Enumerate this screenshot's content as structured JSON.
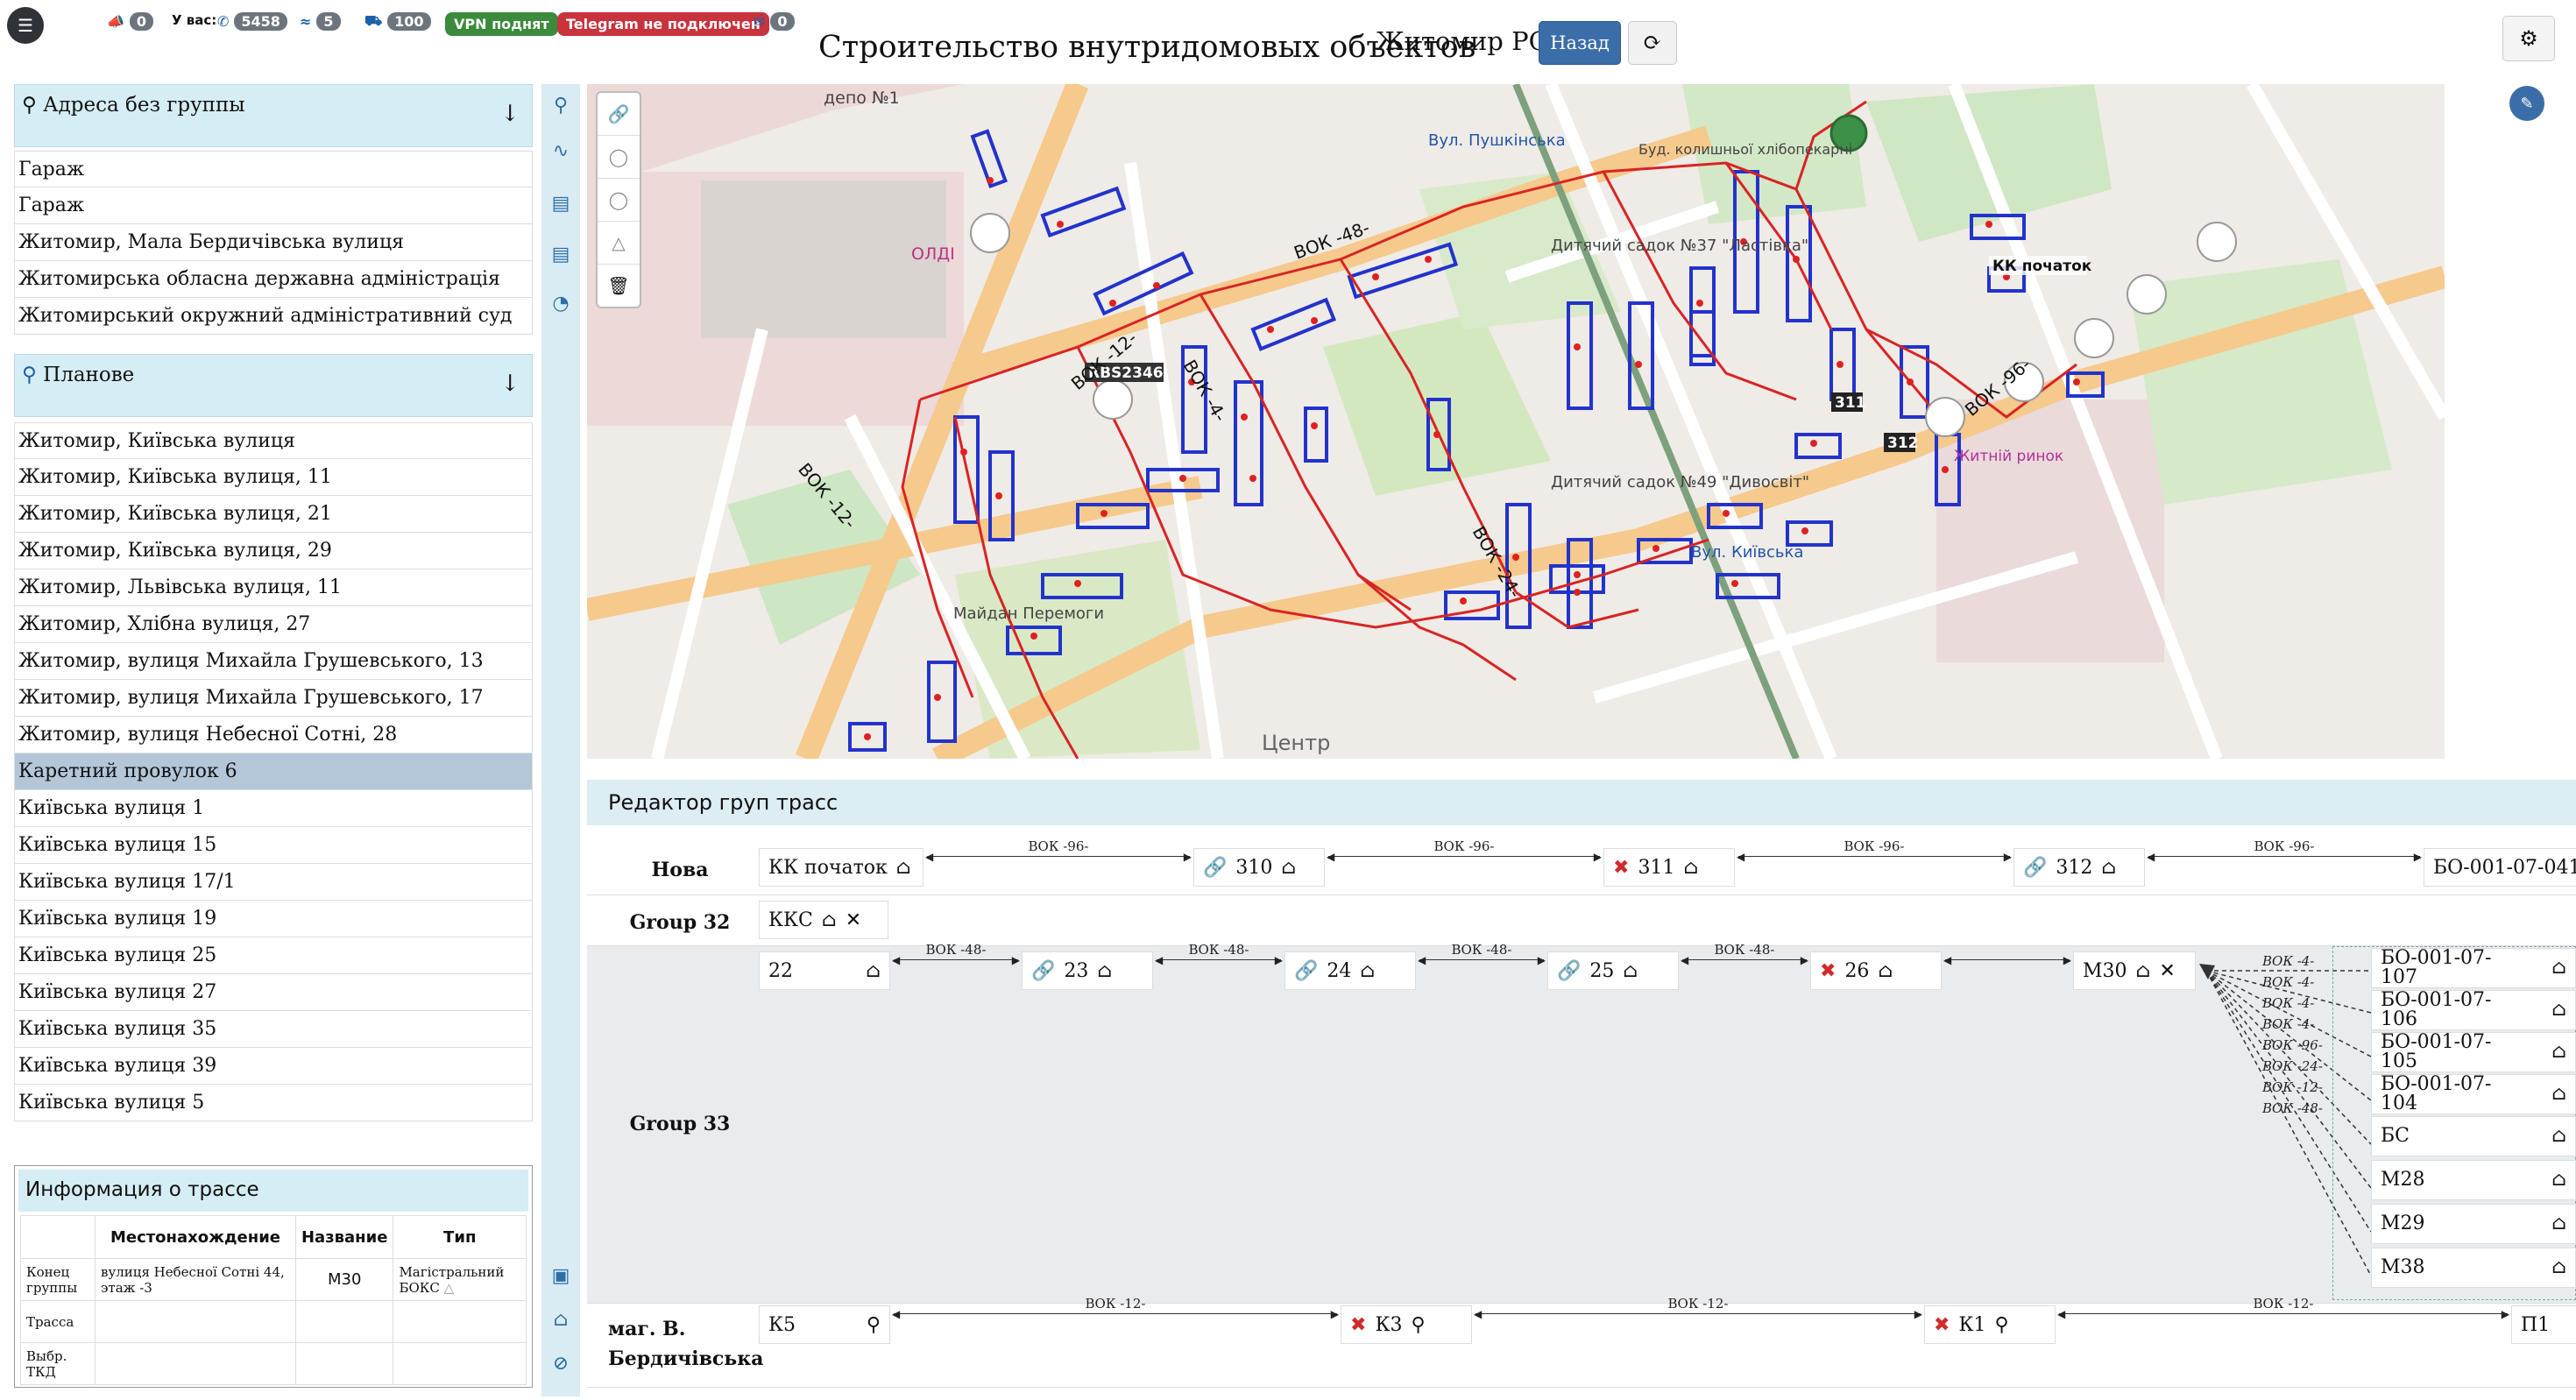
{
  "topbar": {
    "notify_count": "0",
    "you_have_label": "У вас:",
    "phone_count": "5458",
    "wifi_count": "5",
    "truck_count": "100",
    "vpn_status": "VPN поднят",
    "telegram_status": "Telegram не подключен",
    "mail_count": "0",
    "title": "Строительство внутридомовых объектов",
    "subtitle": "Житомир PON",
    "back_label": "Назад"
  },
  "groups": [
    {
      "title": "Адреса без группы",
      "items": [
        "Гараж",
        "Гараж",
        "Житомир, Мала Бердичівська вулиця",
        "Житомирська обласна державна адміністрація",
        "Житомирський окружний адміністративний суд"
      ]
    },
    {
      "title": "Планове",
      "items": [
        "Житомир, Київська вулиця",
        "Житомир, Київська вулиця, 11",
        "Житомир, Київська вулиця, 21",
        "Житомир, Київська вулиця, 29",
        "Житомир, Львівська вулиця, 11",
        "Житомир, Хлібна вулиця, 27",
        "Житомир, вулиця Михайла Грушевського, 13",
        "Житомир, вулиця Михайла Грушевського, 17",
        "Житомир, вулиця Небесної Сотні, 28",
        "Каретний провулок 6",
        "Київська вулиця 1",
        "Київська вулиця 15",
        "Київська вулиця 17/1",
        "Київська вулиця 19",
        "Київська вулиця 25",
        "Київська вулиця 27",
        "Київська вулиця 35",
        "Київська вулиця 39",
        "Київська вулиця 5"
      ]
    }
  ],
  "info": {
    "title": "Информация о трассе",
    "headers": [
      "Местонахождение",
      "Название",
      "Тип"
    ],
    "rows": [
      {
        "label": "Конец группы",
        "location": "вулиця Небесної Сотні 44, этаж -3",
        "name": "М30",
        "type": "Магістральний БОКС"
      },
      {
        "label": "Трасса",
        "location": "",
        "name": "",
        "type": ""
      },
      {
        "label": "Выбр. ТКД",
        "location": "",
        "name": "",
        "type": ""
      }
    ]
  },
  "map": {
    "labels": [
      "депо №1",
      "ОЛДІ",
      "RBS2346",
      "Дитячий садок №37 \"Ластівка\"",
      "Дитячий садок №49 \"Дивосвіт\"",
      "Майдан Перемоги",
      "Центр",
      "КК початок",
      "311",
      "312",
      "Житній ринок",
      "Буд. колишньої хлібопекарні",
      "Вул. Київська",
      "Вул. Пушкінська"
    ],
    "route_labels": [
      "ВОК -12-",
      "ВОК -4-",
      "ВОК -48-",
      "ВОК -96-",
      "ВОК -24-",
      "ВОК -12-"
    ]
  },
  "editor": {
    "title": "Редактор груп трасс",
    "rows": [
      {
        "label": "Нова",
        "nodes": [
          "КК початок",
          "310",
          "311",
          "312",
          "БО-001-07-041"
        ],
        "links": [
          "ВОК -96-",
          "ВОК -96-",
          "ВОК -96-",
          "ВОК -96-"
        ]
      },
      {
        "label": "Group 32",
        "nodes": [
          "ККС"
        ],
        "links": []
      },
      {
        "label": "Group 33",
        "nodes": [
          "22",
          "23",
          "24",
          "25",
          "26",
          "М30"
        ],
        "links": [
          "ВОК -48-",
          "ВОК -48-",
          "ВОК -48-",
          "ВОК -48-",
          ""
        ],
        "branches": [
          "БО-001-07-107",
          "БО-001-07-106",
          "БО-001-07-105",
          "БО-001-07-104",
          "БС",
          "М28",
          "М29",
          "М38"
        ],
        "branch_links": [
          "ВОК -4-",
          "ВОК -4-",
          "ВОК -4-",
          "ВОК -4-",
          "ВОК -96-",
          "ВОК -24-",
          "ВОК -12-",
          "ВОК -48-"
        ]
      },
      {
        "label": "маг. В. Бердичівська",
        "nodes": [
          "К5",
          "К3",
          "К1",
          "П1"
        ],
        "links": [
          "ВОК -12-",
          "ВОК -12-",
          "ВОК -12-"
        ]
      }
    ]
  }
}
